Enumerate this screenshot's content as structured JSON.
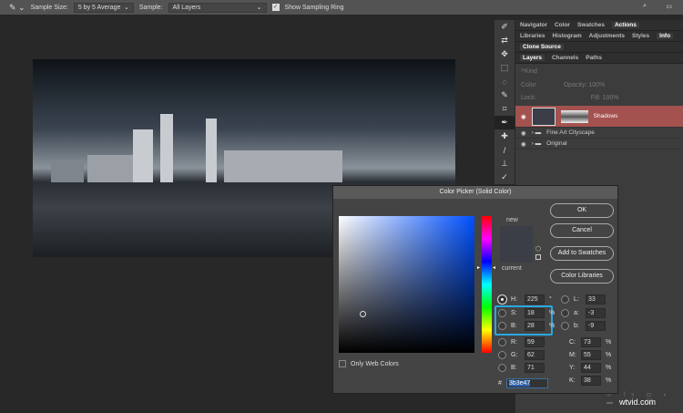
{
  "toolbar": {
    "sample_size_label": "Sample Size:",
    "sample_size": "5 by 5 Average",
    "sample_label": "Sample:",
    "sample": "All Layers",
    "show_ring": "Show Sampling Ring"
  },
  "panels": {
    "tabs1": [
      "Navigator",
      "Color",
      "Swatches",
      "Actions"
    ],
    "tabs2": [
      "Libraries",
      "Histogram",
      "Adjustments",
      "Styles",
      "Info"
    ],
    "tabs3": [
      "Clone Source"
    ],
    "tabs4": [
      "Layers",
      "Channels",
      "Paths"
    ],
    "kind": "Kind",
    "blend": "Color",
    "opacity_label": "Opacity:",
    "opacity": "100%",
    "lock_label": "Lock:",
    "fill_label": "Fill:",
    "fill": "100%",
    "layers": [
      {
        "name": "Shadows"
      },
      {
        "name": "Fine Art Cityscape"
      },
      {
        "name": "Original"
      }
    ]
  },
  "dialog": {
    "title": "Color Picker (Solid Color)",
    "new_label": "new",
    "current_label": "current",
    "ok": "OK",
    "cancel": "Cancel",
    "add_swatches": "Add to Swatches",
    "color_libraries": "Color Libraries",
    "only_web": "Only Web Colors",
    "fields": {
      "H": "225",
      "S": "18",
      "B": "28",
      "R": "59",
      "G": "62",
      "B2": "71",
      "L": "33",
      "a": "-3",
      "b": "-9",
      "C": "73",
      "M": "55",
      "Y": "44",
      "K": "38"
    },
    "deg": "°",
    "pct": "%",
    "hash": "#",
    "hex": "3b3e47",
    "color": "#3b3e47"
  },
  "watermark": "wtvid.com"
}
